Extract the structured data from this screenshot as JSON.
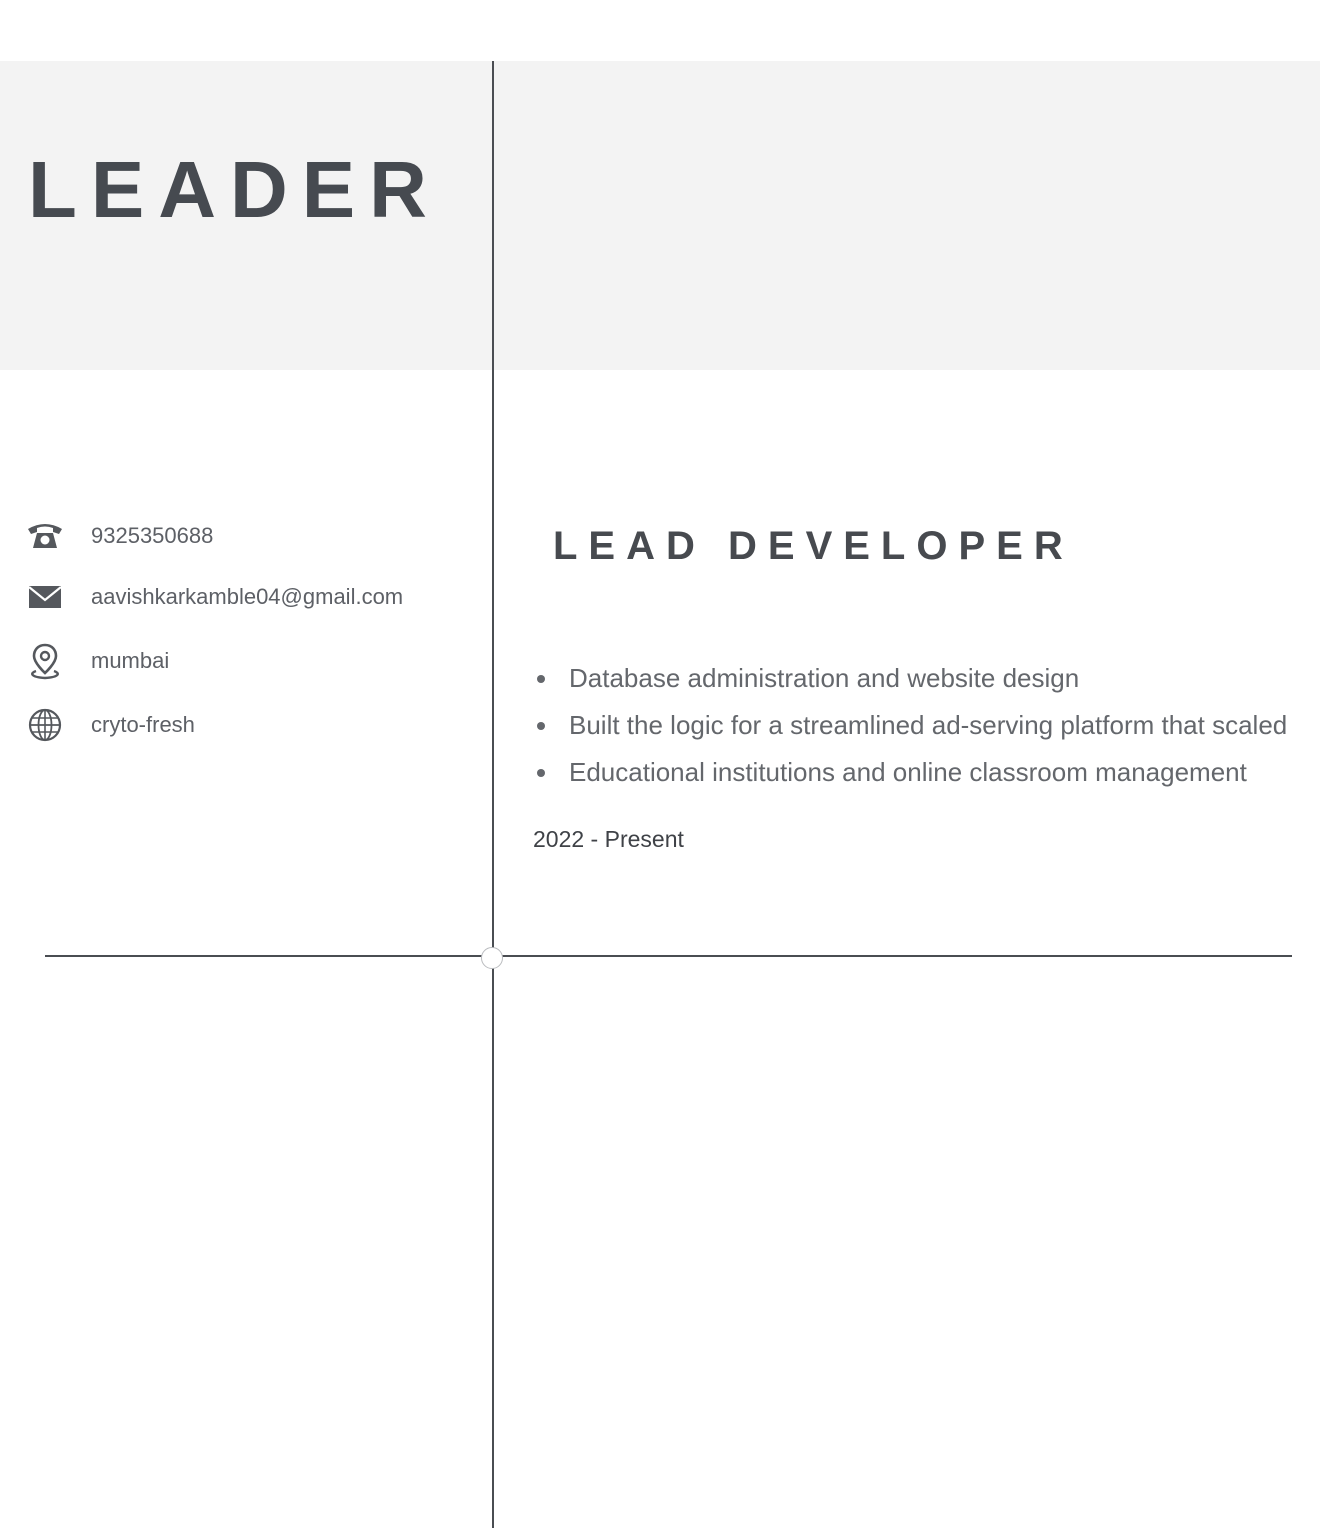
{
  "header": {
    "name": "LEADER"
  },
  "contact": {
    "phone": {
      "icon": "phone-icon",
      "text": "9325350688"
    },
    "email": {
      "icon": "mail-icon",
      "text": "aavishkarkamble04@gmail.com"
    },
    "location": {
      "icon": "location-pin-icon",
      "text": "mumbai"
    },
    "website": {
      "icon": "globe-icon",
      "text": "cryto-fresh"
    }
  },
  "experience": {
    "title": "LEAD DEVELOPER",
    "bullets": [
      "Database administration and website design",
      "Built the logic for a streamlined ad-serving platform that scaled",
      "Educational institutions and online classroom management"
    ],
    "dates": "2022 - Present"
  },
  "colors": {
    "header_band": "#f3f3f3",
    "heading_text": "#474a4f",
    "body_text": "#64676c",
    "rule": "#4a4d52"
  }
}
